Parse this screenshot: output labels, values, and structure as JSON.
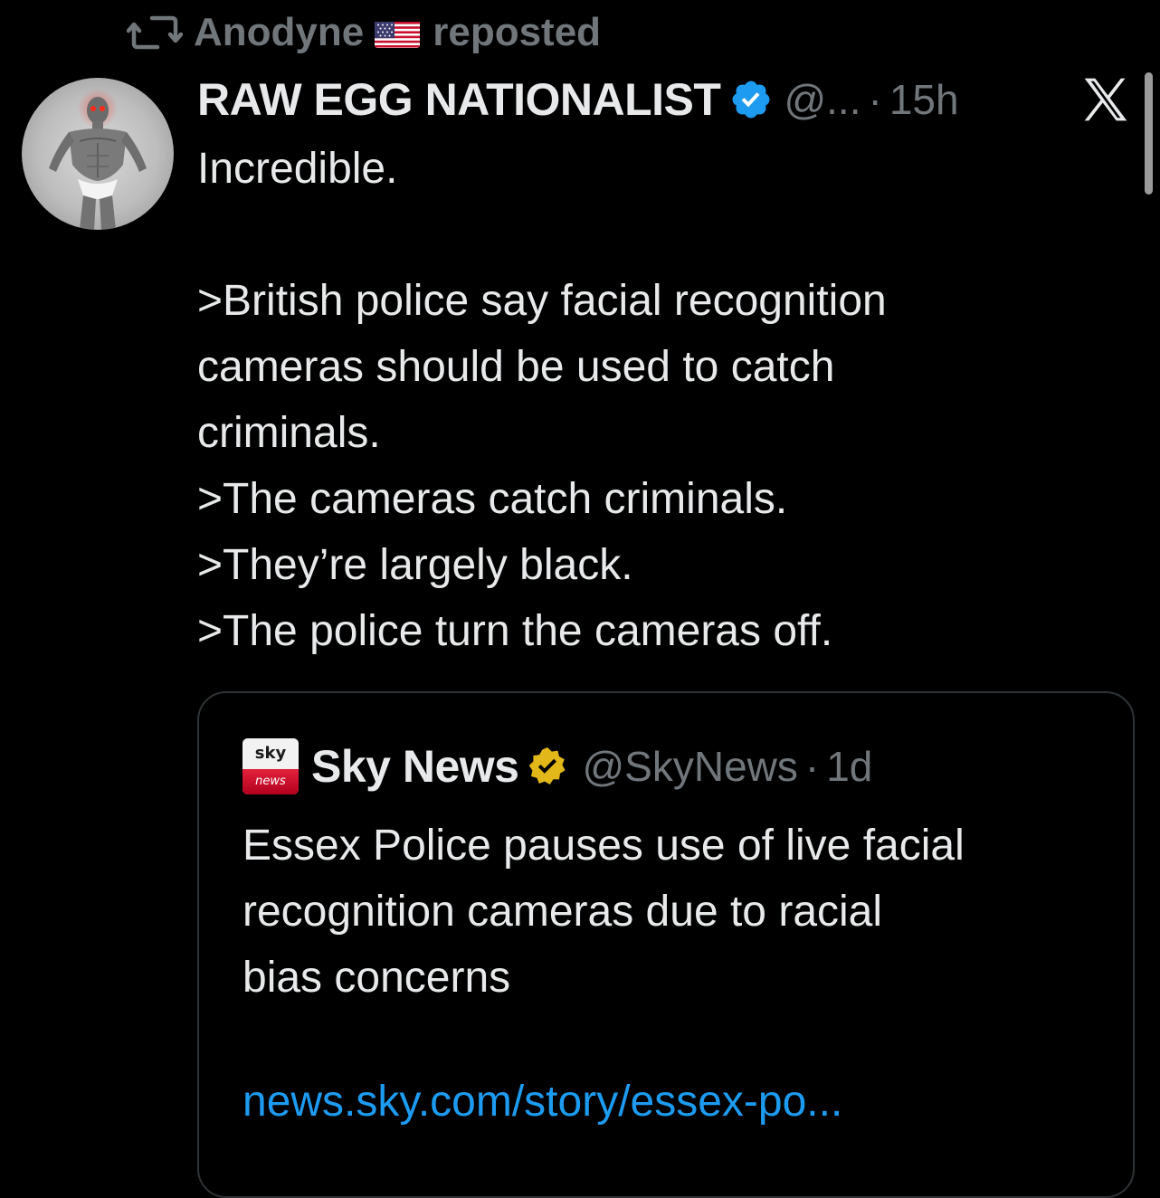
{
  "repost": {
    "user": "Anodyne",
    "flag_emoji": "🇺🇸",
    "label": "reposted",
    "icon": "repost-icon"
  },
  "tweet": {
    "display_name": "RAW EGG NATIONALIST",
    "verified_icon": "verified-badge-blue",
    "handle": "@...",
    "separator": "·",
    "time": "15h",
    "text_lines": [
      "Incredible.",
      "",
      ">British police say facial recognition",
      "cameras should be used to catch",
      "criminals.",
      ">The cameras catch criminals.",
      ">They’re largely black.",
      ">The police turn the cameras off."
    ]
  },
  "quote": {
    "logo_top": "sky",
    "logo_bottom": "news",
    "display_name": "Sky News",
    "verified_icon": "verified-badge-gold",
    "handle": "@SkyNews",
    "separator": "·",
    "time": "1d",
    "text_lines": [
      "Essex Police pauses use of live facial",
      "recognition cameras due to racial",
      "bias concerns"
    ],
    "link": "news.sky.com/story/essex-po..."
  },
  "colors": {
    "background": "#000000",
    "text_primary": "#e7e9ea",
    "text_secondary": "#71767b",
    "link": "#1d9bf0",
    "verified_blue": "#1d9bf0",
    "verified_gold": "#e2b719",
    "border": "#2f3336"
  },
  "icons": {
    "platform_logo": "x-logo-icon"
  }
}
